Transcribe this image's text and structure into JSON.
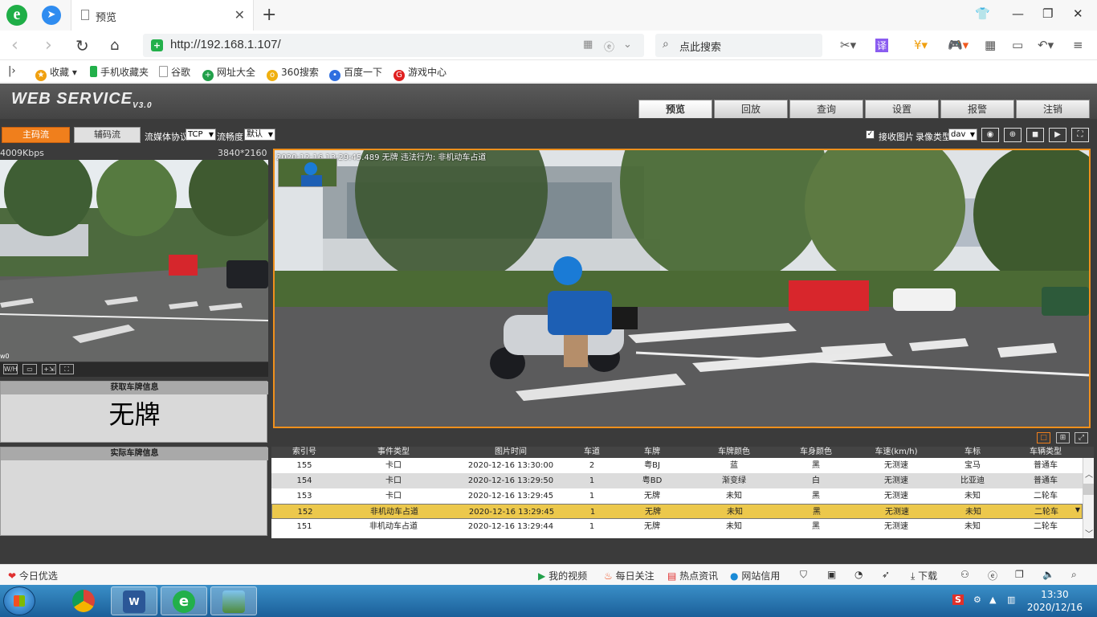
{
  "browser": {
    "tab_title": "预览",
    "url": "http://192.168.1.107/",
    "search_placeholder": "点此搜索",
    "translate_label": "译",
    "favorites": [
      {
        "label": "收藏"
      },
      {
        "label": "手机收藏夹"
      },
      {
        "label": "谷歌"
      },
      {
        "label": "网址大全"
      },
      {
        "label": "360搜索"
      },
      {
        "label": "百度一下"
      },
      {
        "label": "游戏中心"
      }
    ]
  },
  "app": {
    "logo": "WEB  SERVICE",
    "version": "V3.0",
    "nav_tabs": [
      {
        "label": "预览",
        "active": true
      },
      {
        "label": "回放"
      },
      {
        "label": "查询"
      },
      {
        "label": "设置"
      },
      {
        "label": "报警"
      },
      {
        "label": "注销"
      }
    ]
  },
  "toolbar": {
    "main_stream": "主码流",
    "sub_stream": "辅码流",
    "protocol_label": "流媒体协议",
    "protocol_value": "TCP",
    "fluency_label": "流畅度",
    "fluency_value": "默认",
    "receive_pic_label": "接收图片",
    "receive_pic_checked": true,
    "record_type_label": "录像类型",
    "record_type_value": "dav"
  },
  "small_video": {
    "bitrate": "4009Kbps",
    "resolution": "3840*2160",
    "tag": "w0",
    "controls": [
      "W/H",
      "▭",
      "+⇲",
      "⛶"
    ]
  },
  "plate_info": {
    "captured_header": "获取车牌信息",
    "captured_value": "无牌",
    "actual_header": "实际车牌信息",
    "actual_value": ""
  },
  "main_video": {
    "overlay_text": "2020-12-16 13:29:45.489 无牌 违法行为: 非机动车占道"
  },
  "event_table": {
    "columns": [
      "索引号",
      "事件类型",
      "图片时间",
      "车道",
      "车牌",
      "车牌颜色",
      "车身颜色",
      "车速(km/h)",
      "车标",
      "车辆类型"
    ],
    "rows": [
      {
        "idx": "155",
        "type": "卡口",
        "time": "2020-12-16 13:30:00",
        "lane": "2",
        "plate": "粤BJ",
        "plate_color": "蓝",
        "body_color": "黑",
        "speed": "无测速",
        "brand": "宝马",
        "vtype": "普通车"
      },
      {
        "idx": "154",
        "type": "卡口",
        "time": "2020-12-16 13:29:50",
        "lane": "1",
        "plate": "粤BD",
        "plate_color": "渐变绿",
        "body_color": "白",
        "speed": "无测速",
        "brand": "比亚迪",
        "vtype": "普通车"
      },
      {
        "idx": "153",
        "type": "卡口",
        "time": "2020-12-16 13:29:45",
        "lane": "1",
        "plate": "无牌",
        "plate_color": "未知",
        "body_color": "黑",
        "speed": "无测速",
        "brand": "未知",
        "vtype": "二轮车"
      },
      {
        "idx": "152",
        "type": "非机动车占道",
        "time": "2020-12-16 13:29:45",
        "lane": "1",
        "plate": "无牌",
        "plate_color": "未知",
        "body_color": "黑",
        "speed": "无测速",
        "brand": "未知",
        "vtype": "二轮车"
      },
      {
        "idx": "151",
        "type": "非机动车占道",
        "time": "2020-12-16 13:29:44",
        "lane": "1",
        "plate": "无牌",
        "plate_color": "未知",
        "body_color": "黑",
        "speed": "无测速",
        "brand": "未知",
        "vtype": "二轮车"
      }
    ],
    "selected_index": "152"
  },
  "statusbar": {
    "left": "今日优选",
    "items": [
      "我的视频",
      "每日关注",
      "热点资讯",
      "网站信用"
    ],
    "download": "下载"
  },
  "taskbar": {
    "time": "13:30",
    "date": "2020/12/16"
  },
  "colors": {
    "accent_orange": "#f07f1c",
    "selected_row": "#ecc84c",
    "page_bg": "#3b3b3b"
  }
}
